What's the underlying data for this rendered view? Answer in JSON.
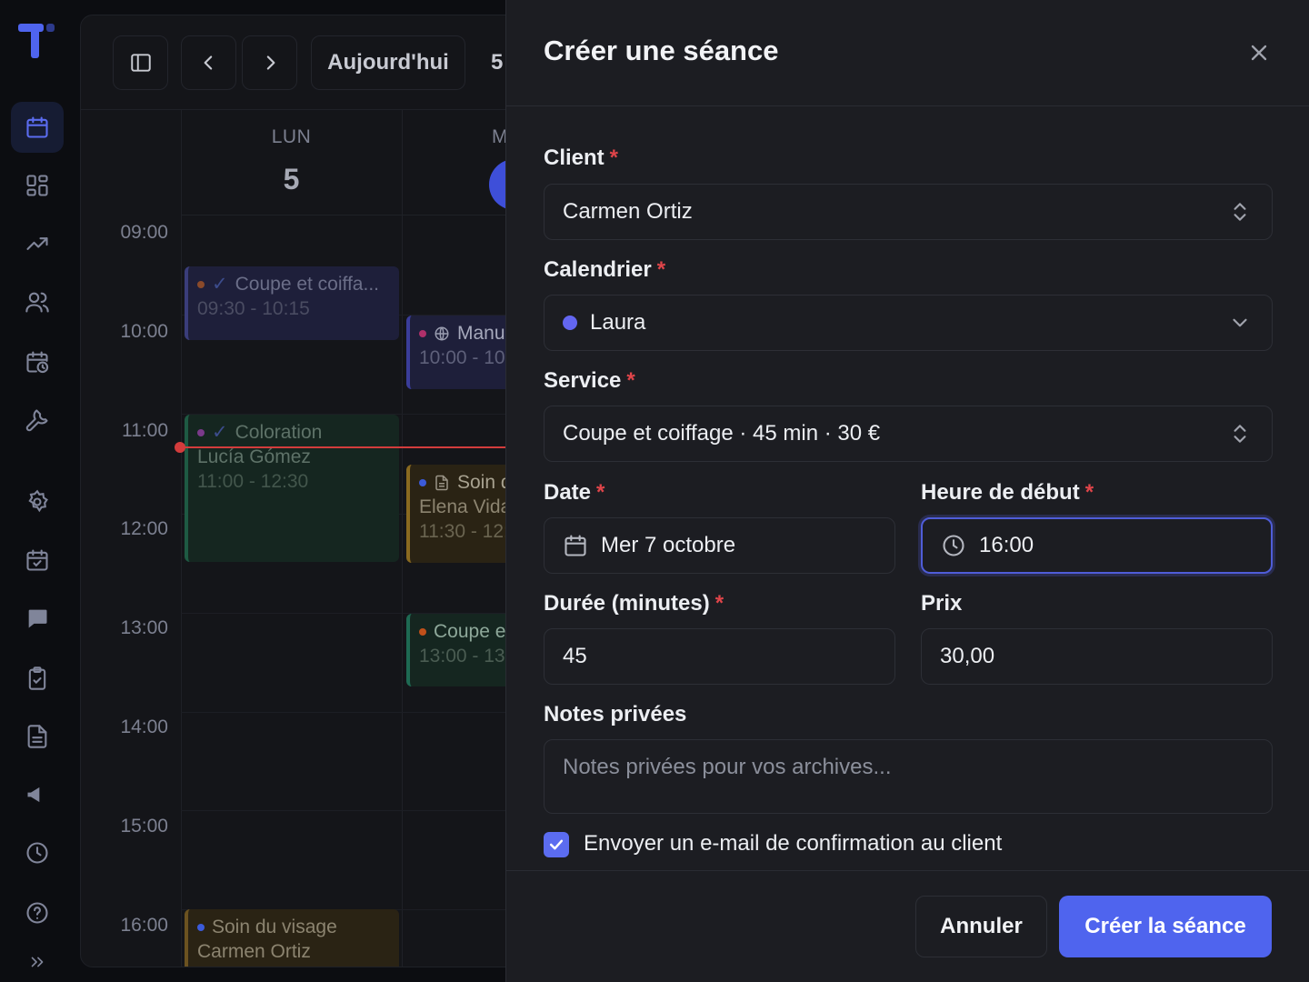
{
  "colors": {
    "accent": "#4f64ee",
    "required": "#e0454a",
    "calendar_dot": "#6366f1",
    "now_line": "#d33c3c"
  },
  "sidebar": {
    "items": [
      {
        "icon": "calendar-icon",
        "active": true
      },
      {
        "icon": "dashboard-icon"
      },
      {
        "icon": "trending-up-icon"
      },
      {
        "icon": "users-icon"
      },
      {
        "icon": "calendar-clock-icon"
      },
      {
        "icon": "wrench-icon"
      },
      {
        "icon": "settings-icon"
      },
      {
        "icon": "calendar-check-icon"
      },
      {
        "icon": "message-icon"
      },
      {
        "icon": "clipboard-check-icon"
      },
      {
        "icon": "file-text-icon"
      },
      {
        "icon": "megaphone-icon"
      },
      {
        "icon": "clock-icon"
      },
      {
        "icon": "help-icon"
      },
      {
        "icon": "expand-icon"
      }
    ]
  },
  "calendar": {
    "today_label": "Aujourd'hui",
    "range_label_partial": "5",
    "days": [
      {
        "dow": "LUN",
        "num": "5"
      },
      {
        "dow": "M",
        "num": ""
      }
    ],
    "hours": [
      "09:00",
      "10:00",
      "11:00",
      "12:00",
      "13:00",
      "14:00",
      "15:00",
      "16:00"
    ],
    "events": [
      {
        "title": "Coupe et coiffa...",
        "client": "",
        "time": "09:30 - 10:15"
      },
      {
        "title": "Coloration",
        "client": "Lucía Gómez",
        "time": "11:00 - 12:30"
      },
      {
        "title": "Soin du visage",
        "client": "Carmen Ortiz",
        "time": ""
      },
      {
        "title": "Manu",
        "client": "",
        "time": "10:00 - 10:"
      },
      {
        "title": "Soin d",
        "client": "Elena Vida",
        "time": "11:30 - 12:"
      },
      {
        "title": "Coupe e",
        "client": "",
        "time": "13:00 - 13"
      }
    ]
  },
  "dialog": {
    "title": "Créer une séance",
    "client": {
      "label": "Client",
      "value": "Carmen Ortiz"
    },
    "calendar": {
      "label": "Calendrier",
      "value": "Laura"
    },
    "service": {
      "label": "Service",
      "value": "Coupe et coiffage · 45 min · 30 €"
    },
    "date": {
      "label": "Date",
      "value": "Mer 7 octobre"
    },
    "start_time": {
      "label": "Heure de début",
      "value": "16:00"
    },
    "duration": {
      "label": "Durée (minutes)",
      "value": "45"
    },
    "price": {
      "label": "Prix",
      "value": "30,00"
    },
    "notes": {
      "label": "Notes privées",
      "placeholder": "Notes privées pour vos archives..."
    },
    "send_email": {
      "label": "Envoyer un e-mail de confirmation au client",
      "checked": true
    },
    "cancel_label": "Annuler",
    "submit_label": "Créer la séance",
    "required_mark": "*"
  }
}
